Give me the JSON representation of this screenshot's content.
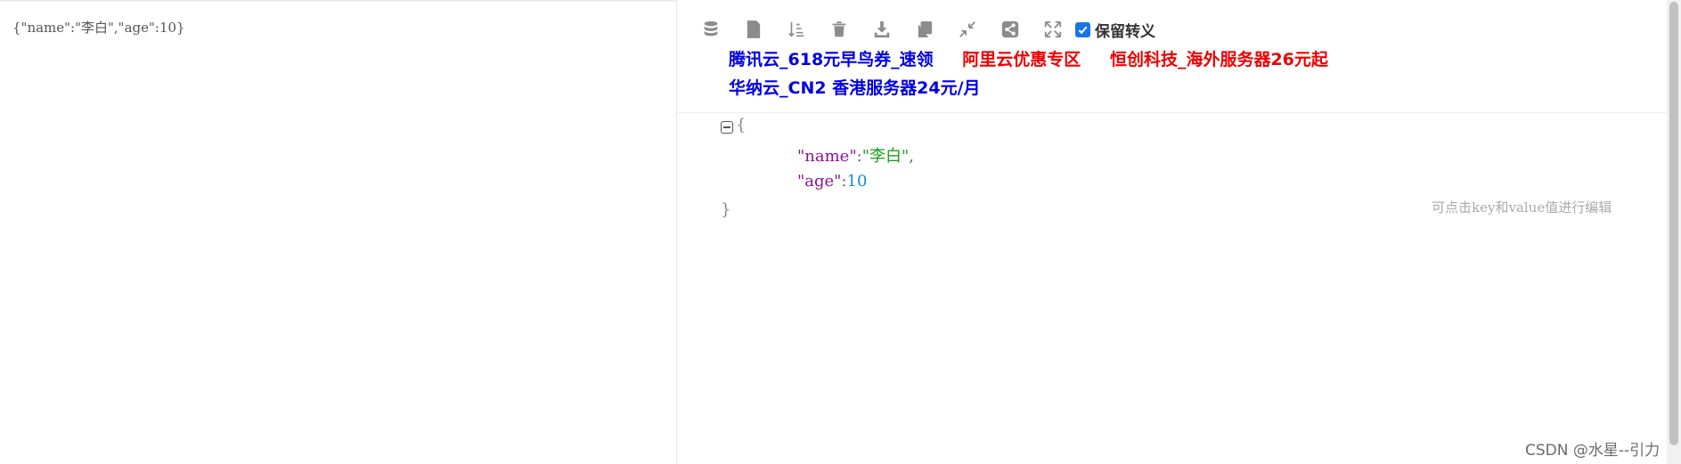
{
  "input_pane": {
    "raw_text": "{\"name\":\"李白\",\"age\":10}"
  },
  "toolbar": {
    "tools": [
      {
        "icon": "database-icon"
      },
      {
        "icon": "excel-file-icon"
      },
      {
        "icon": "sort-icon"
      },
      {
        "icon": "trash-icon"
      },
      {
        "icon": "download-icon"
      },
      {
        "icon": "copy-icon"
      },
      {
        "icon": "compress-icon"
      },
      {
        "icon": "share-icon"
      },
      {
        "icon": "expand-icon"
      }
    ],
    "keep_escape_label": "保留转义",
    "keep_escape_checked": true,
    "accent_color": "#1a73e8"
  },
  "ads": {
    "row1": [
      "腾讯云_618元早鸟券_速领",
      "阿里云优惠专区",
      "恒创科技_海外服务器26元起"
    ],
    "row2": [
      "华纳云_CN2 香港服务器24元/月"
    ],
    "colors": {
      "blue": "#0000e6",
      "red": "#ee0000"
    }
  },
  "tree": {
    "open_brace": "{",
    "close_brace": "}",
    "entries": [
      {
        "key": "\"name\"",
        "colon": ":",
        "value": "\"李白\"",
        "comma": ","
      },
      {
        "key": "\"age\"",
        "colon": ":",
        "value": "10",
        "comma": ""
      }
    ],
    "colors": {
      "key": "#881391",
      "string": "#1a9e1a",
      "number": "#1c8bd0"
    }
  },
  "hint": "可点击key和value值进行编辑",
  "watermark": "CSDN @水星--引力"
}
